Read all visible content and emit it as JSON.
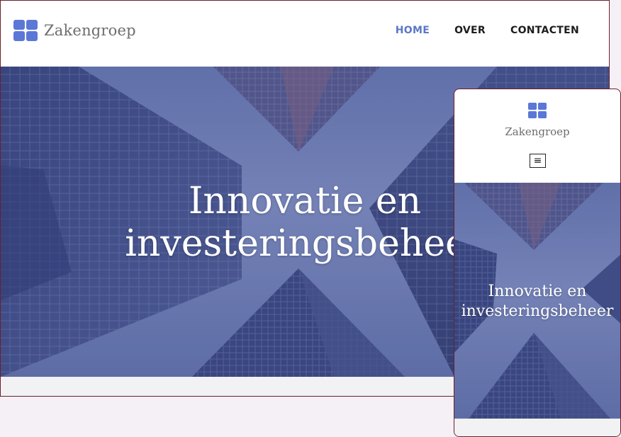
{
  "brand": {
    "name": "Zakengroep",
    "logo_icon": "grid-four-squares-icon",
    "logo_color": "#5b78d6"
  },
  "nav": {
    "items": [
      {
        "label": "HOME",
        "active": true
      },
      {
        "label": "OVER",
        "active": false
      },
      {
        "label": "CONTACTEN",
        "active": false
      }
    ],
    "active_color": "#5b78c6"
  },
  "hero": {
    "title_line1": "Innovatie en",
    "title_line2": "investeringsbeheer",
    "overlay_color": "#5f6ea8"
  },
  "mobile": {
    "menu_icon": "hamburger-menu-icon"
  }
}
